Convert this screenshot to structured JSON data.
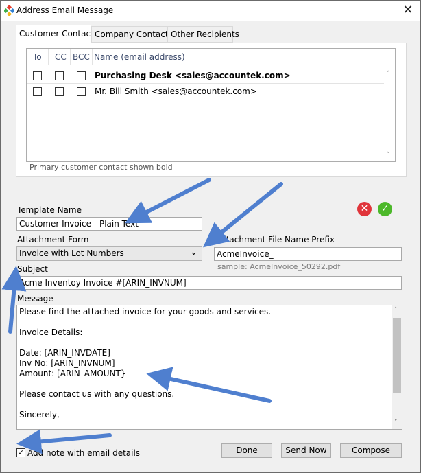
{
  "window": {
    "title": "Address Email Message",
    "close_glyph": "✕"
  },
  "tabs": [
    "Customer Contacts",
    "Company Contacts",
    "Other Recipients"
  ],
  "contacts": {
    "headers": {
      "to": "To",
      "cc": "CC",
      "bcc": "BCC",
      "name": "Name (email address)"
    },
    "rows": [
      {
        "name": "Purchasing Desk <sales@accountek.com>",
        "bold": true,
        "to": false,
        "cc": false,
        "bcc": false
      },
      {
        "name": "Mr. Bill Smith <sales@accountek.com>",
        "bold": false,
        "to": false,
        "cc": false,
        "bcc": false
      }
    ],
    "note": "Primary customer contact shown bold",
    "scroll_up": "˄",
    "scroll_down": "˅"
  },
  "template": {
    "label": "Template Name",
    "value": "Customer Invoice - Plain Text"
  },
  "actions": {
    "cancel_glyph": "✕",
    "accept_glyph": "✓",
    "cancel_color": "#e0353b",
    "accept_color": "#4cb82a"
  },
  "attachment_form": {
    "label": "Attachment Form",
    "value": "Invoice with Lot Numbers",
    "chevron": "⌄"
  },
  "attachment_prefix": {
    "label": "Attachment File Name Prefix",
    "value": "AcmeInvoice_",
    "sample": "sample: AcmeInvoice_50292.pdf"
  },
  "subject": {
    "label": "Subject",
    "value": "Acme Inventoy Invoice #[ARIN_INVNUM]"
  },
  "message": {
    "label": "Message",
    "body": "Please find the attached invoice for your goods and services.\n\nInvoice Details:\n\nDate: [ARIN_INVDATE]\nInv No: [ARIN_INVNUM]\nAmount: [ARIN_AMOUNT}\n\nPlease contact us with any questions.\n\nSincerely,"
  },
  "add_note": {
    "label": "Add note with email details",
    "checked": true,
    "check_glyph": "✓"
  },
  "buttons": {
    "done": "Done",
    "send_now": "Send Now",
    "compose": "Compose"
  },
  "colors": {
    "annotation_arrow": "#4f7fcf"
  }
}
